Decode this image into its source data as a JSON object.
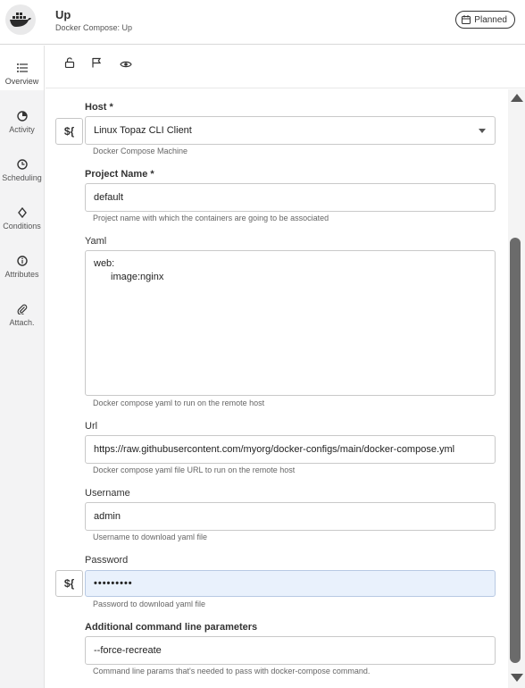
{
  "header": {
    "title": "Up",
    "subtitle": "Docker Compose: Up",
    "status_badge": "Planned",
    "logo_icon": "docker-whale-icon"
  },
  "sidebar": {
    "items": [
      {
        "label": "Overview",
        "icon": "list-icon",
        "active": true
      },
      {
        "label": "Activity",
        "icon": "pie-chart-icon"
      },
      {
        "label": "Scheduling",
        "icon": "clock-icon"
      },
      {
        "label": "Conditions",
        "icon": "diamond-icon"
      },
      {
        "label": "Attributes",
        "icon": "info-icon"
      },
      {
        "label": "Attach.",
        "icon": "paperclip-icon"
      }
    ]
  },
  "toolbar": {
    "icons": [
      "unlock-icon",
      "flag-icon",
      "eye-icon"
    ]
  },
  "form": {
    "var_button_label": "${",
    "host": {
      "label": "Host *",
      "value": "Linux Topaz CLI Client",
      "help": "Docker Compose Machine"
    },
    "project_name": {
      "label": "Project Name *",
      "value": "default",
      "help": "Project name with which the containers are going to be associated"
    },
    "yaml": {
      "label": "Yaml",
      "line1": "web:",
      "line2": "image:nginx",
      "help": "Docker compose yaml to run on the remote host"
    },
    "url": {
      "label": "Url",
      "value": "https://raw.githubusercontent.com/myorg/docker-configs/main/docker-compose.yml",
      "help": "Docker compose yaml file URL to run on the remote host"
    },
    "username": {
      "label": "Username",
      "value": "admin",
      "help": "Username to download yaml file"
    },
    "password": {
      "label": "Password",
      "value": "•••••••••",
      "help": "Password to download yaml file"
    },
    "additional_params": {
      "label": "Additional command line parameters",
      "value": "--force-recreate",
      "help": "Command line params that's needed to pass with docker-compose command."
    }
  },
  "colors": {
    "accent_focus_bg": "#e9f1fc",
    "sidebar_bg": "#f3f3f4",
    "scroll_thumb": "#6b6b6b"
  }
}
